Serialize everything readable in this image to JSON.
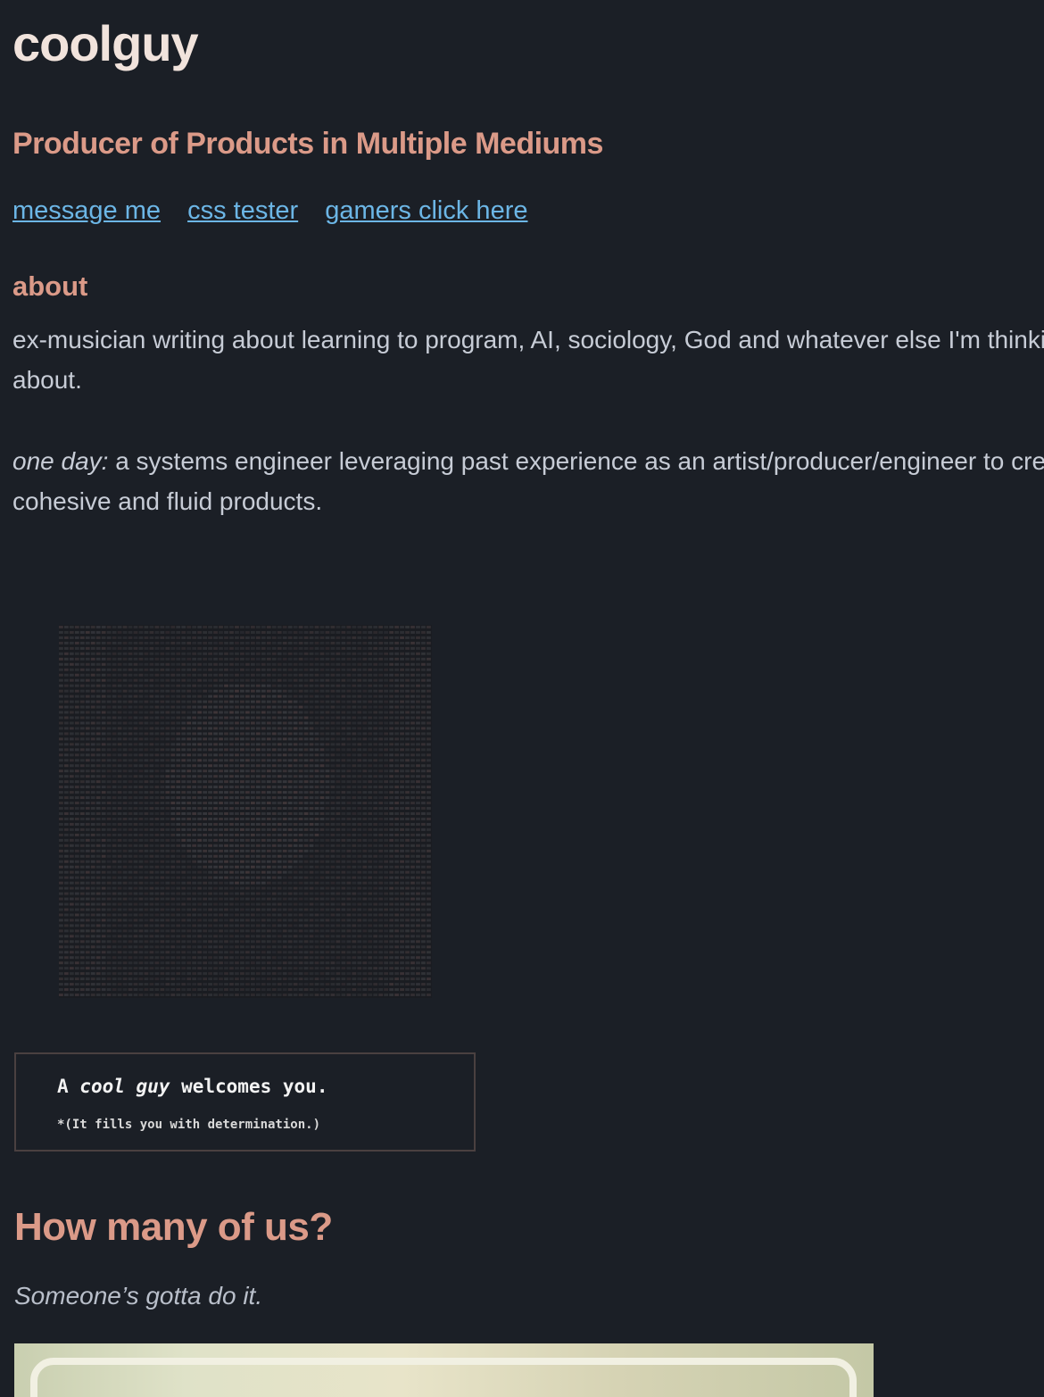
{
  "header": {
    "title": "coolguy",
    "tagline": "Producer of Products in Multiple Mediums"
  },
  "nav": {
    "links": [
      {
        "label": "message me"
      },
      {
        "label": "css tester"
      },
      {
        "label": "gamers click here"
      }
    ]
  },
  "about": {
    "heading": "about",
    "paragraph1": "ex-musician writing about learning to program, AI, sociology, God and whatever else I'm thinking about.",
    "paragraph2_prefix": "one day:",
    "paragraph2_rest": " a systems engineer leveraging past experience as an artist/producer/engineer to create cohesive and fluid products."
  },
  "welcome": {
    "prefix": "A ",
    "emphasis": "cool guy",
    "suffix": " welcomes you.",
    "sub": "*(It fills you with determination.)"
  },
  "section": {
    "heading": "How many of us?",
    "subtitle": "Someone’s gotta do it."
  },
  "colors": {
    "background": "#1b1f26",
    "accent": "#db9a88",
    "link": "#6cb6e6",
    "text": "#c7ccd6"
  }
}
